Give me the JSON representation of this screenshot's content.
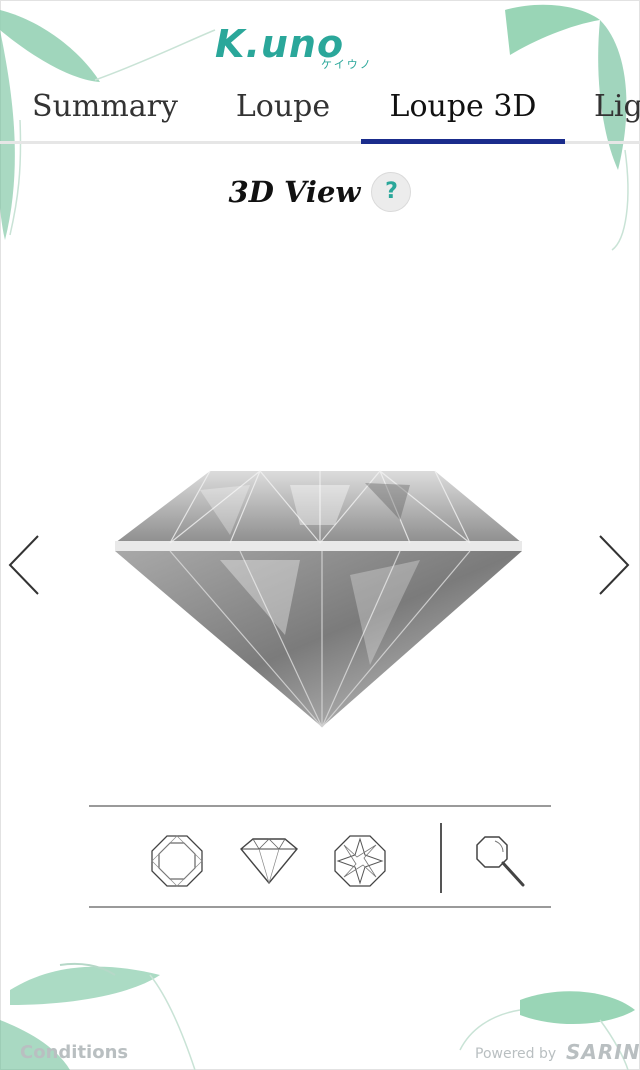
{
  "brand": {
    "logo_text": "K.uno",
    "logo_sub": "ケイウノ",
    "accent_color": "#2aa79a",
    "tab_indicator_color": "#1a2c8c"
  },
  "tabs": [
    {
      "label": "Summary",
      "active": false
    },
    {
      "label": "Loupe",
      "active": false
    },
    {
      "label": "Loupe 3D",
      "active": true
    },
    {
      "label": "Lig",
      "active": false
    }
  ],
  "view": {
    "title": "3D View",
    "help_label": "?"
  },
  "toolbar": {
    "tools": [
      {
        "name": "top-view",
        "icon": "octagon-top-view-icon"
      },
      {
        "name": "side-view",
        "icon": "diamond-side-view-icon"
      },
      {
        "name": "bottom-view",
        "icon": "star-bottom-view-icon"
      },
      {
        "name": "zoom",
        "icon": "magnifier-icon"
      }
    ]
  },
  "footer": {
    "conditions": "Conditions",
    "powered_by": "Powered by",
    "sarine": "SARINE"
  }
}
